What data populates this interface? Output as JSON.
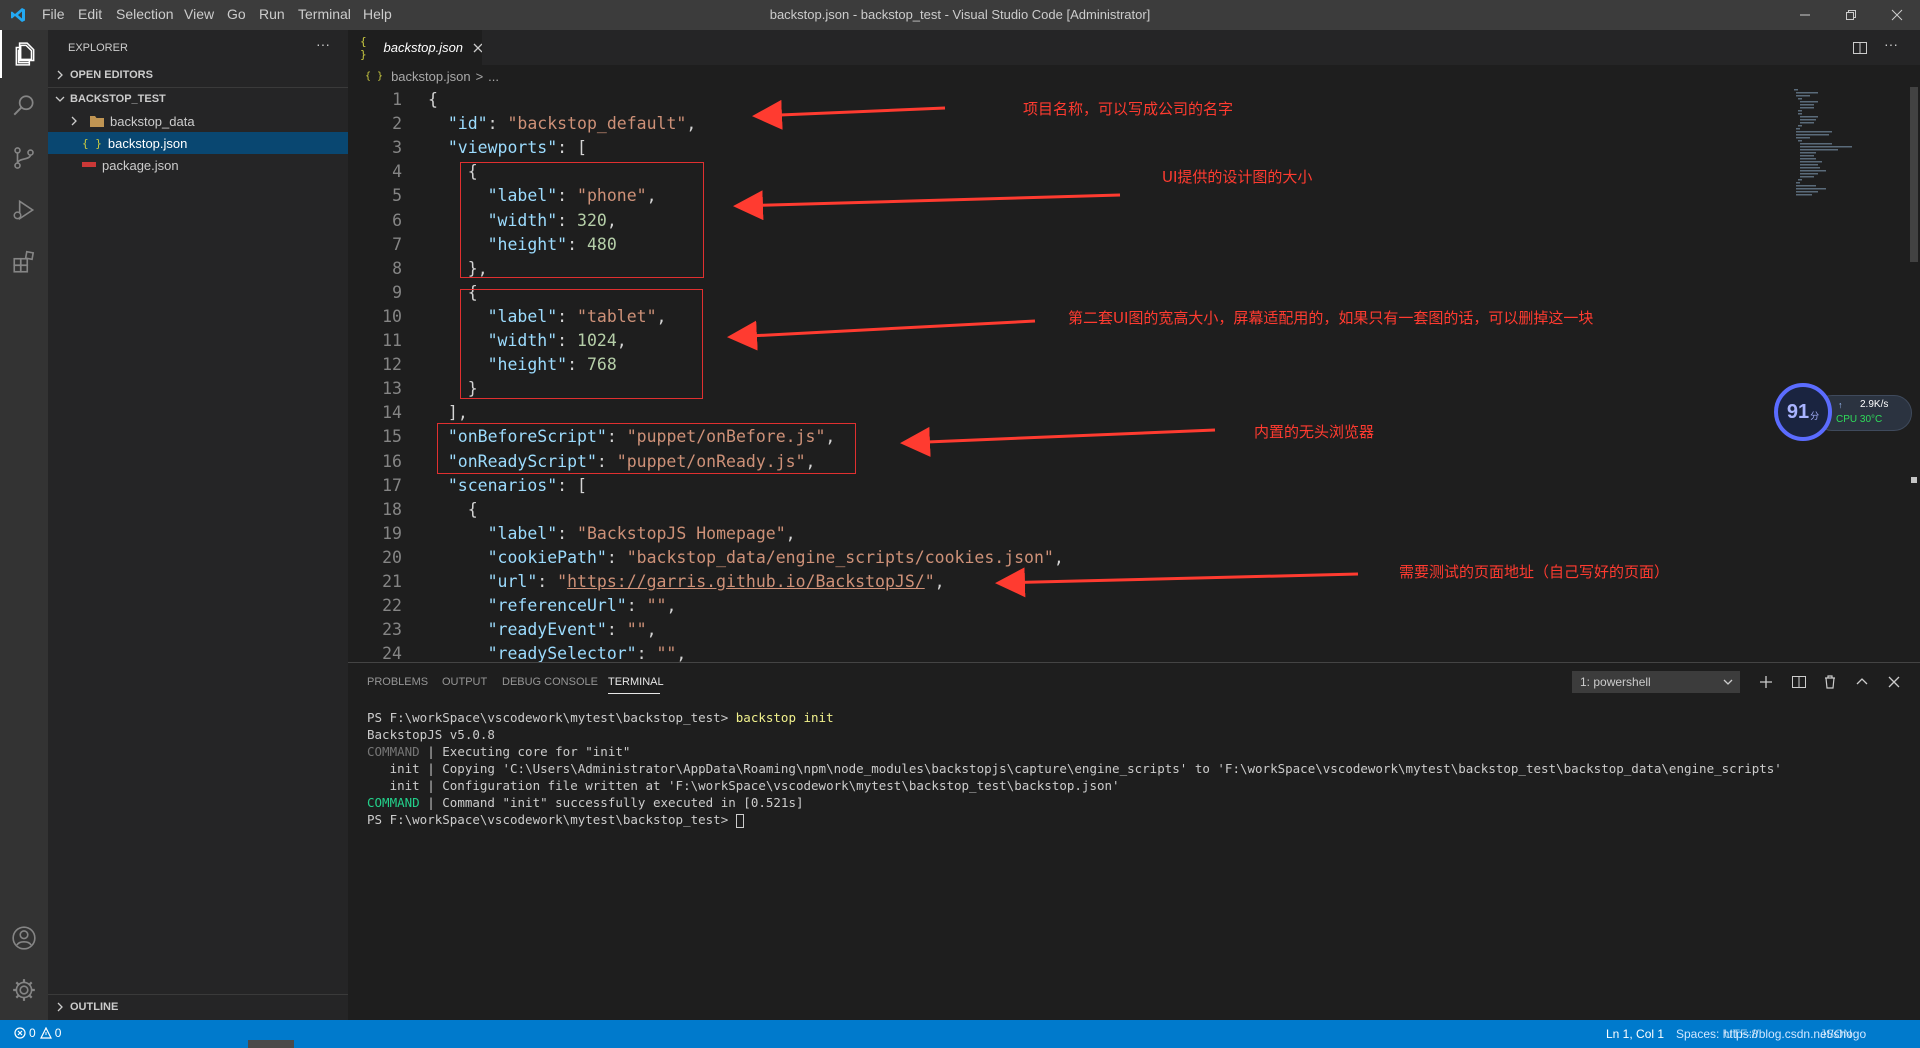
{
  "title_bar": {
    "menus": [
      "File",
      "Edit",
      "Selection",
      "View",
      "Go",
      "Run",
      "Terminal",
      "Help"
    ],
    "window_title": "backstop.json - backstop_test - Visual Studio Code [Administrator]"
  },
  "sidebar": {
    "header": "EXPLORER",
    "more": "···",
    "open_editors": "OPEN EDITORS",
    "folder": "BACKSTOP_TEST",
    "items": [
      {
        "label": "backstop_data",
        "icon": "folder-icon"
      },
      {
        "label": "backstop.json",
        "icon": "json-icon",
        "selected": true
      },
      {
        "label": "package.json",
        "icon": "npm-icon"
      }
    ],
    "outline": "OUTLINE"
  },
  "editor": {
    "tab_label": "backstop.json",
    "tab_icon_glyph": "{ }",
    "breadcrumb_file": "backstop.json",
    "breadcrumb_sep": ">",
    "breadcrumb_more": "...",
    "line_numbers": [
      "1",
      "2",
      "3",
      "4",
      "5",
      "6",
      "7",
      "8",
      "9",
      "10",
      "11",
      "12",
      "13",
      "14",
      "15",
      "16",
      "17",
      "18",
      "19",
      "20",
      "21",
      "22",
      "23",
      "24"
    ],
    "lines": [
      "{",
      "  \"id\": \"backstop_default\",",
      "  \"viewports\": [",
      "    {",
      "      \"label\": \"phone\",",
      "      \"width\": 320,",
      "      \"height\": 480",
      "    },",
      "    {",
      "      \"label\": \"tablet\",",
      "      \"width\": 1024,",
      "      \"height\": 768",
      "    }",
      "  ],",
      "  \"onBeforeScript\": \"puppet/onBefore.js\",",
      "  \"onReadyScript\": \"puppet/onReady.js\",",
      "  \"scenarios\": [",
      "    {",
      "      \"label\": \"BackstopJS Homepage\",",
      "      \"cookiePath\": \"backstop_data/engine_scripts/cookies.json\",",
      "      \"url\": \"https://garris.github.io/BackstopJS/\",",
      "      \"referenceUrl\": \"\",",
      "      \"readyEvent\": \"\",",
      "      \"readySelector\": \"\","
    ]
  },
  "annotations": [
    "项目名称，可以写成公司的名字",
    "UI提供的设计图的大小",
    "第二套UI图的宽高大小，屏幕适配用的，如果只有一套图的话，可以删掉这一块",
    "内置的无头浏览器",
    "需要测试的页面地址（自己写好的页面）"
  ],
  "panel": {
    "tabs": [
      "PROBLEMS",
      "OUTPUT",
      "DEBUG CONSOLE",
      "TERMINAL"
    ],
    "active_tab": "TERMINAL",
    "terminal_select": "1: powershell",
    "lines": [
      {
        "prefix": "PS F:\\workSpace\\vscodework\\mytest\\backstop_test> ",
        "cmd": "backstop init"
      },
      {
        "text": "BackstopJS v5.0.8"
      },
      {
        "tag": "COMMAND",
        "text": " | Executing core for \"init\""
      },
      {
        "text": "   init | Copying 'C:\\Users\\Administrator\\AppData\\Roaming\\npm\\node_modules\\backstopjs\\capture\\engine_scripts' to 'F:\\workSpace\\vscodework\\mytest\\backstop_test\\backstop_data\\engine_scripts'"
      },
      {
        "text": "   init | Configuration file written at 'F:\\workSpace\\vscodework\\mytest\\backstop_test\\backstop.json'"
      },
      {
        "tag": "COMMAND",
        "text": " | Command \"init\" successfully executed in [0.521s]"
      },
      {
        "prefix": "PS F:\\workSpace\\vscodework\\mytest\\backstop_test> ",
        "cursor": true
      }
    ]
  },
  "widget": {
    "score": "91",
    "unit": "分",
    "speed": "2.9K/s",
    "cpu": "CPU 30°C"
  },
  "status_bar": {
    "errors": "0",
    "warnings": "0",
    "position": "Ln 1, Col 1",
    "overlap": "Spaces: https://blog.csdn.net/shogo",
    "encoding": "UTF-8",
    "lang": "JSON"
  },
  "colors": {
    "accent": "#007acc",
    "annotation": "#ff3b30"
  }
}
